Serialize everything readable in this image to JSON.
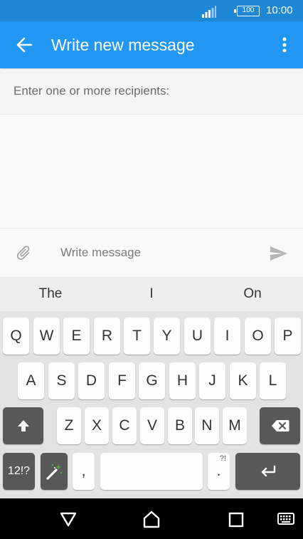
{
  "status_bar": {
    "battery": "100",
    "time": "10:00",
    "icons": [
      "signal-icon",
      "battery-icon"
    ]
  },
  "app_bar": {
    "title": "Write new message",
    "icons": [
      "back-arrow-icon",
      "more-vert-icon"
    ]
  },
  "recipients": {
    "placeholder": "Enter one or more recipients:",
    "value": ""
  },
  "compose": {
    "placeholder": "Write message",
    "value": "",
    "icons": [
      "attachment-icon",
      "send-icon"
    ]
  },
  "suggestions": [
    "The",
    "I",
    "On"
  ],
  "keyboard": {
    "row1": [
      "Q",
      "W",
      "E",
      "R",
      "T",
      "Y",
      "U",
      "I",
      "O",
      "P"
    ],
    "row2": [
      "A",
      "S",
      "D",
      "F",
      "G",
      "H",
      "J",
      "K",
      "L"
    ],
    "row3": [
      "Z",
      "X",
      "C",
      "V",
      "B",
      "N",
      "M"
    ],
    "symbols_key": "12!?",
    "comma_key": ",",
    "period_key": ".",
    "period_hint": "?!",
    "icons": [
      "shift-icon",
      "backspace-icon",
      "magic-wand-icon",
      "enter-icon"
    ]
  },
  "nav_bar": {
    "icons": [
      "back-triangle-icon",
      "home-icon",
      "recents-icon",
      "keyboard-icon"
    ]
  },
  "colors": {
    "app_bar": "#2196f3",
    "status_bar": "#1e88d6",
    "keyboard_bg": "#e3e3e3",
    "dark_key": "#585858"
  }
}
